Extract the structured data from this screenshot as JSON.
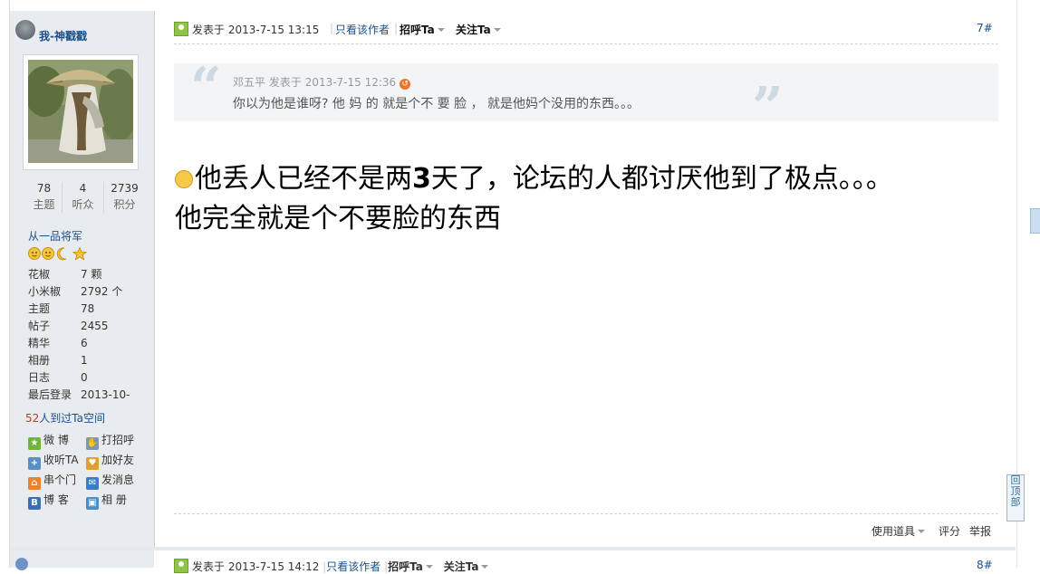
{
  "user": {
    "name": "我-神戳戳",
    "stats": [
      {
        "value": "78",
        "label": "主题"
      },
      {
        "value": "4",
        "label": "听众"
      },
      {
        "value": "2739",
        "label": "积分"
      }
    ],
    "rank": "从一品将军",
    "info": [
      {
        "key": "花椒",
        "value": "7 颗"
      },
      {
        "key": "小米椒",
        "value": "2792 个"
      },
      {
        "key": "主题",
        "value": "78"
      },
      {
        "key": "帖子",
        "value": "2455"
      },
      {
        "key": "精华",
        "value": "6"
      },
      {
        "key": "相册",
        "value": "1"
      },
      {
        "key": "日志",
        "value": "0"
      },
      {
        "key": "最后登录",
        "value": "2013-10-"
      }
    ],
    "visits_count": "52",
    "visits_text": "人到过Ta空间",
    "actions": [
      {
        "label": "微 博",
        "icon": "weibo-icon",
        "color": "#6fb63a"
      },
      {
        "label": "打招呼",
        "icon": "greet-icon",
        "color": "#7d98b2"
      },
      {
        "label": "收听TA",
        "icon": "follow-icon",
        "color": "#5a8fc5"
      },
      {
        "label": "加好友",
        "icon": "add-friend-icon",
        "color": "#e0a030"
      },
      {
        "label": "串个门",
        "icon": "home-icon",
        "color": "#e8822d"
      },
      {
        "label": "发消息",
        "icon": "message-icon",
        "color": "#3a7fc4"
      },
      {
        "label": "博 客",
        "icon": "blog-icon",
        "color": "#3a6fb5"
      },
      {
        "label": "相 册",
        "icon": "album-icon",
        "color": "#4a8fc8"
      }
    ]
  },
  "post": {
    "posted_label": "发表于",
    "posted_time": "2013-7-15 13:15",
    "only_author": "只看该作者",
    "greet": "招呼Ta",
    "follow": "关注Ta",
    "floor": "7#",
    "quote": {
      "author": "邓五平",
      "posted_label": "发表于",
      "time": "2013-7-15 12:36",
      "text": "你以为他是谁呀? 他 妈 的 就是个不 要 脸 ， 就是他妈个没用的东西。。。"
    },
    "body_line1_a": "他丢人已经不是两",
    "body_line1_b": "3",
    "body_line1_c": "天了，论坛的人都讨厌他到了极点。。。",
    "body_line2": "他完全就是个不要脸的东西",
    "footer": {
      "tools": "使用道具",
      "rate": "评分",
      "report": "举报"
    }
  },
  "next_post": {
    "posted_label": "发表于",
    "posted_time": "2013-7-15 14:12",
    "only_author": "只看该作者",
    "greet": "招呼Ta",
    "follow": "关注Ta",
    "floor": "8#"
  },
  "back_to_top": "回顶部",
  "colors": {
    "link": "#1b4e8a",
    "accent": "#e8762c",
    "sidebar_bg": "#e8ecef"
  }
}
